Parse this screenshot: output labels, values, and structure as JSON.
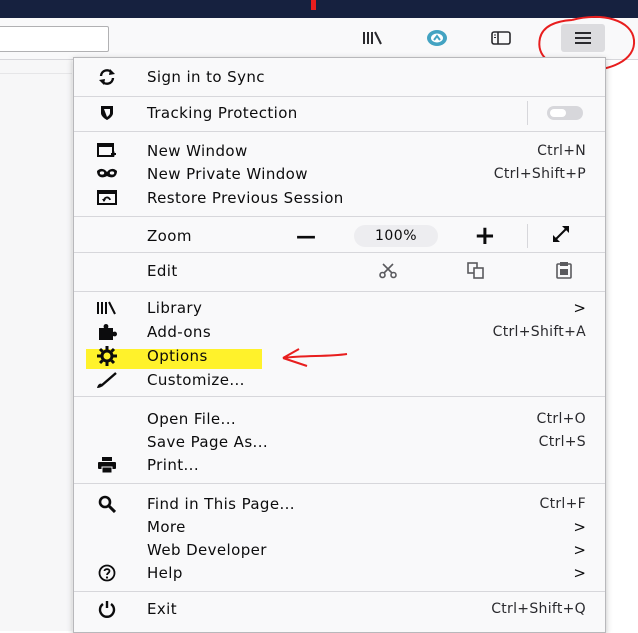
{
  "menu": {
    "sync": {
      "label": "Sign in to Sync"
    },
    "tracking": {
      "label": "Tracking Protection"
    },
    "new_window": {
      "label": "New Window",
      "shortcut": "Ctrl+N"
    },
    "private_window": {
      "label": "New Private Window",
      "shortcut": "Ctrl+Shift+P"
    },
    "restore": {
      "label": "Restore Previous Session"
    },
    "zoom": {
      "label": "Zoom",
      "minus": "—",
      "value": "100%",
      "plus": "+"
    },
    "edit": {
      "label": "Edit"
    },
    "library": {
      "label": "Library",
      "arrow": ">"
    },
    "addons": {
      "label": "Add-ons",
      "shortcut": "Ctrl+Shift+A"
    },
    "options": {
      "label": "Options"
    },
    "customize": {
      "label": "Customize..."
    },
    "open_file": {
      "label": "Open File...",
      "shortcut": "Ctrl+O"
    },
    "save_page": {
      "label": "Save Page As...",
      "shortcut": "Ctrl+S"
    },
    "print": {
      "label": "Print..."
    },
    "find": {
      "label": "Find in This Page...",
      "shortcut": "Ctrl+F"
    },
    "more": {
      "label": "More",
      "arrow": ">"
    },
    "webdev": {
      "label": "Web Developer",
      "arrow": ">"
    },
    "help": {
      "label": "Help",
      "arrow": ">"
    },
    "exit": {
      "label": "Exit",
      "shortcut": "Ctrl+Shift+Q"
    }
  },
  "toolbar": {
    "icons": [
      "library-icon",
      "extension-icon",
      "sidebar-icon",
      "hamburger-menu-icon"
    ]
  },
  "colors": {
    "highlight": "#fff22b",
    "annotation": "#e81e1e",
    "topbar": "#16213f"
  }
}
